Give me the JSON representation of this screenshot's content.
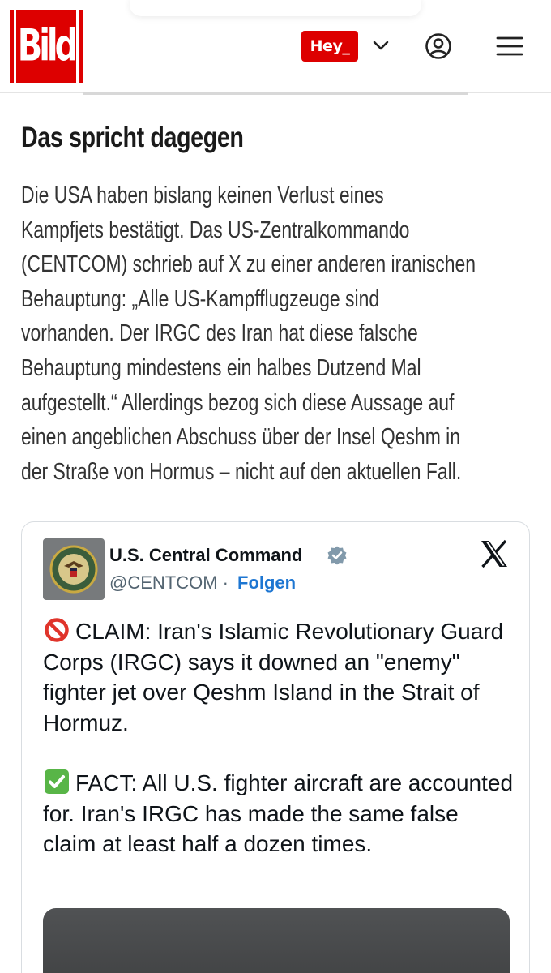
{
  "brand": {
    "logo_text": "Bild",
    "color": "#dd0000"
  },
  "header": {
    "hey_label": "Hey_",
    "icons": [
      "chevron-down-icon",
      "account-icon",
      "menu-icon"
    ]
  },
  "article": {
    "headline": "Das spricht dagegen",
    "body_lines": [
      "Die USA haben bislang keinen Verlust eines",
      "Kampfjets bestätigt. Das US-Zentralkommando",
      "(CENTCOM) schrieb auf X zu einer anderen iranischen",
      "Behauptung: „Alle US-Kampfflugzeuge sind",
      "vorhanden. Der IRGC des Iran hat diese falsche",
      "Behauptung mindestens ein halbes Dutzend Mal",
      "aufgestellt.“ Allerdings bezog sich diese Aussage auf",
      "einen angeblichen Abschuss über der Insel Qeshm in",
      "der Straße von Hormus – nicht auf den aktuellen Fall."
    ]
  },
  "tweet": {
    "author_name": "U.S. Central Command",
    "handle": "@CENTCOM",
    "separator": "·",
    "follow_label": "Folgen",
    "claim": "CLAIM: Iran's Islamic Revolutionary Guard Corps (IRGC) says it downed an \"enemy\" fighter jet over Qeshm Island in the Strait of Hormuz.",
    "fact": "FACT: All U.S. fighter aircraft are accounted for. Iran's IRGC has made the same false claim at least half a dozen times.",
    "colors": {
      "follow": "#1d76d2",
      "verified": "#829aab"
    }
  }
}
